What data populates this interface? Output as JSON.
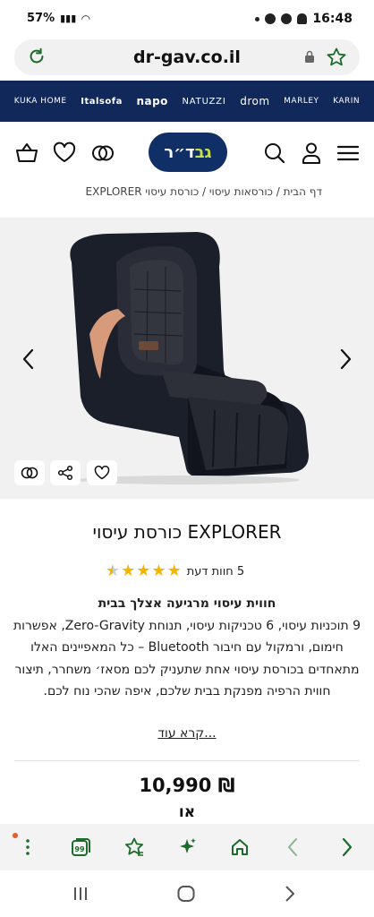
{
  "status": {
    "battery": "57%",
    "time": "16:48"
  },
  "browser": {
    "url": "dr-gav.co.il"
  },
  "brands": [
    "KUKA HOME",
    "Italsofa",
    "napo",
    "NATUZZI",
    "drom",
    "MARLEY",
    "KARIN"
  ],
  "header": {
    "logo_text": "ד״ר",
    "logo_accent": "גב"
  },
  "breadcrumb": "דף הבית / כורסאות עיסוי / כורסת עיסוי EXPLORER",
  "product": {
    "title": "כורסת עיסוי EXPLORER",
    "rating": 4.5,
    "reviews_text": "5 חוות דעת",
    "desc_lead": "חווית עיסוי מרגיעה אצלך בבית",
    "desc_body": "9 תוכניות עיסוי, 6 טכניקות עיסוי, תנוחת Zero-Gravity, אפשרות חימום, ורמקול עם חיבור Bluetooth – כל המאפיינים האלו מתאחדים בכורסת עיסוי אחת שתעניק לכם מסאז׳ משחרר, תיצור חווית הרפיה מפנקת בבית שלכם, איפה שהכי נוח לכם.",
    "read_more": "קרא עוד...",
    "price": "10,990 ₪",
    "or_label": "או"
  },
  "colors": {
    "navy": "#10295a",
    "accent_green": "#1e6a2c",
    "star": "#f5b400"
  }
}
